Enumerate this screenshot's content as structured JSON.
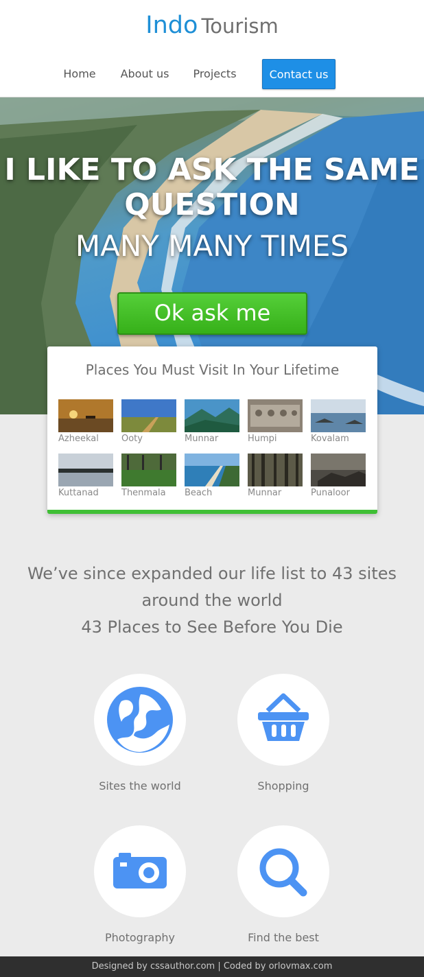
{
  "header": {
    "logo_primary": "Indo",
    "logo_secondary": "Tourism",
    "nav": [
      {
        "label": "Home"
      },
      {
        "label": "About us"
      },
      {
        "label": "Projects"
      },
      {
        "label": "Contact us"
      }
    ]
  },
  "hero": {
    "line1": "I LIKE TO ASK THE SAME",
    "line2": "QUESTION",
    "line3": "MANY MANY TIMES",
    "cta_label": "Ok ask me"
  },
  "places": {
    "title": "Places You Must Visit In Your Lifetime",
    "items": [
      {
        "label": "Azheekal"
      },
      {
        "label": "Ooty"
      },
      {
        "label": "Munnar"
      },
      {
        "label": "Humpi"
      },
      {
        "label": "Kovalam"
      },
      {
        "label": "Kuttanad"
      },
      {
        "label": "Thenmala"
      },
      {
        "label": "Beach"
      },
      {
        "label": "Munnar"
      },
      {
        "label": "Punaloor"
      }
    ]
  },
  "tagline": {
    "line1": "We’ve since expanded our life list to 43 sites",
    "line2": "around the world",
    "line3": "43 Places to See Before You Die"
  },
  "features": [
    {
      "label": "Sites the world",
      "icon": "globe-icon"
    },
    {
      "label": "Shopping",
      "icon": "basket-icon"
    },
    {
      "label": "Photography",
      "icon": "camera-icon"
    },
    {
      "label": "Find the best",
      "icon": "search-icon"
    }
  ],
  "footer": {
    "credit": "Designed by cssauthor.com | Coded by orlovmax.com"
  },
  "colors": {
    "brand_blue": "#1e8fd6",
    "button_blue": "#1e8fe6",
    "cta_green": "#3fbf35",
    "icon_blue": "#4c93f3",
    "page_bg": "#ebebeb",
    "footer_bg": "#2f2f2f"
  }
}
